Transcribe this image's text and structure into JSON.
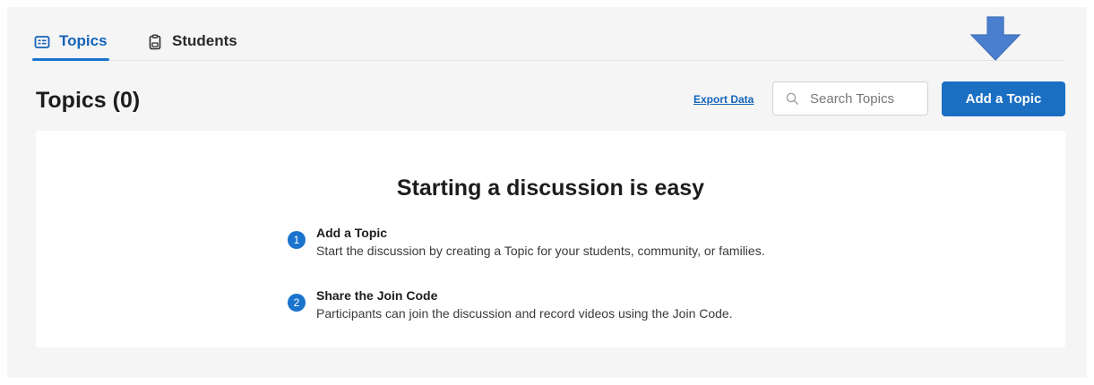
{
  "tabs": [
    {
      "label": "Topics",
      "icon": "topics-icon",
      "active": true
    },
    {
      "label": "Students",
      "icon": "clipboard-icon",
      "active": false
    }
  ],
  "header": {
    "title": "Topics (0)",
    "export_label": "Export Data",
    "search_placeholder": "Search Topics",
    "add_button_label": "Add a Topic"
  },
  "empty_state": {
    "heading": "Starting a discussion is easy",
    "steps": [
      {
        "number": "1",
        "title": "Add a Topic",
        "description": "Start the discussion by creating a Topic for your students, community, or families."
      },
      {
        "number": "2",
        "title": "Share the Join Code",
        "description": "Participants can join the discussion and record videos using the Join Code."
      }
    ]
  },
  "colors": {
    "accent": "#1a6fc2",
    "annotation_arrow": "#4a7fd0",
    "background": "#f5f5f6"
  },
  "annotation": {
    "icon": "down-arrow-icon"
  }
}
